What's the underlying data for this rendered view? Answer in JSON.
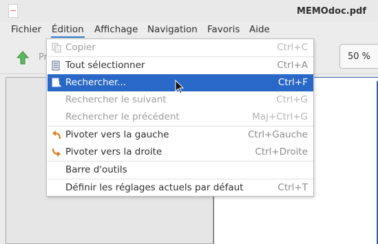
{
  "window": {
    "title": "MEMOdoc.pdf"
  },
  "menubar": {
    "items": [
      {
        "label": "Fichier"
      },
      {
        "label": "Édition"
      },
      {
        "label": "Affichage"
      },
      {
        "label": "Navigation"
      },
      {
        "label": "Favoris"
      },
      {
        "label": "Aide"
      }
    ],
    "active": "Édition"
  },
  "toolbar": {
    "partial_label": "Pr",
    "zoom_value": "50 %"
  },
  "edit_menu": {
    "items": [
      {
        "label": "Copier",
        "shortcut": "Ctrl+C",
        "enabled": false,
        "icon": "copy-icon"
      },
      {
        "label": "Tout sélectionner",
        "shortcut": "Ctrl+A",
        "enabled": true,
        "icon": "select-all-icon"
      },
      {
        "label": "Rechercher...",
        "shortcut": "Ctrl+F",
        "enabled": true,
        "icon": "find-icon",
        "highlighted": true
      },
      {
        "label": "Rechercher le suivant",
        "shortcut": "Ctrl+G",
        "enabled": false
      },
      {
        "label": "Rechercher le précédent",
        "shortcut": "Maj+Ctrl+G",
        "enabled": false
      },
      {
        "label": "Pivoter vers la gauche",
        "shortcut": "Ctrl+Gauche",
        "enabled": true,
        "icon": "rotate-left-icon"
      },
      {
        "label": "Pivoter vers la droite",
        "shortcut": "Ctrl+Droite",
        "enabled": true,
        "icon": "rotate-right-icon"
      },
      {
        "label": "Barre d'outils",
        "shortcut": "",
        "enabled": true
      },
      {
        "label": "Définir les réglages actuels par défaut",
        "shortcut": "Ctrl+T",
        "enabled": true
      }
    ]
  },
  "colors": {
    "highlight": "#2a68c7",
    "accent_underline": "#2a76c6",
    "icon_orange": "#e07b1a",
    "arrow_green": "#4caf50"
  }
}
